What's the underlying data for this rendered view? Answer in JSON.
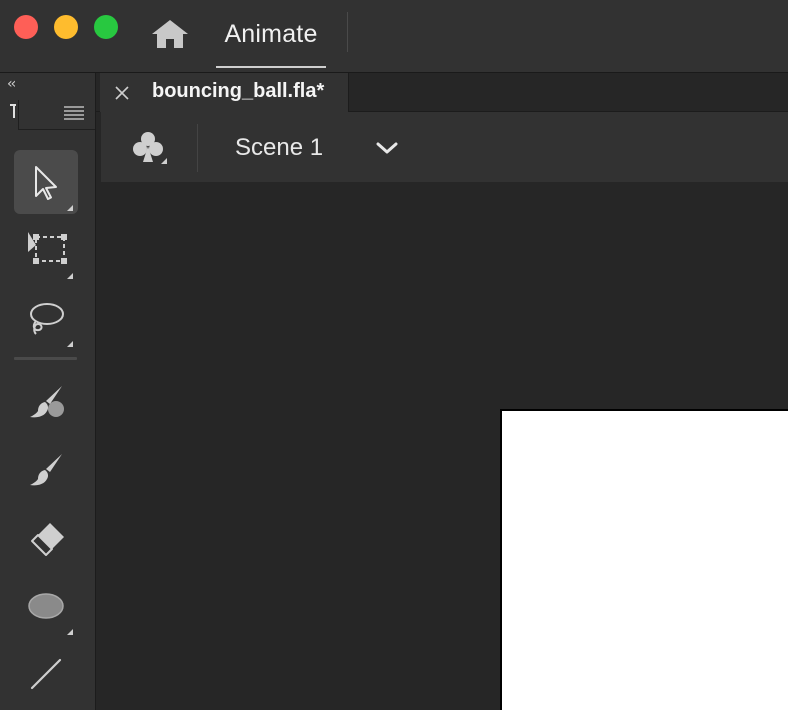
{
  "window": {
    "controls": [
      "close",
      "minimize",
      "maximize"
    ],
    "home_icon": "home-icon",
    "app_tab_label": "Animate"
  },
  "panel": {
    "collapse_glyph": "‹‹",
    "menu_icon": "hamburger-menu-icon"
  },
  "tools": [
    {
      "name": "selection-tool",
      "icon": "arrow-pointer-icon",
      "active": true
    },
    {
      "name": "free-transform-tool",
      "icon": "free-transform-icon",
      "active": false
    },
    {
      "name": "lasso-tool",
      "icon": "lasso-icon",
      "active": false
    },
    {
      "name": "paint-brush-tool",
      "icon": "paint-brush-icon",
      "active": false
    },
    {
      "name": "brush-tool",
      "icon": "brush-icon",
      "active": false
    },
    {
      "name": "eraser-tool",
      "icon": "eraser-icon",
      "active": false
    },
    {
      "name": "oval-tool",
      "icon": "oval-icon",
      "active": false
    },
    {
      "name": "line-tool",
      "icon": "line-icon",
      "active": false
    }
  ],
  "document": {
    "tab_title": "bouncing_ball.fla*",
    "close_glyph": "×"
  },
  "scene_bar": {
    "edit_symbols_icon": "club-symbol-icon",
    "scene_name": "Scene 1",
    "dropdown_icon": "chevron-down-icon"
  },
  "colors": {
    "accent_close": "#fe5f57",
    "accent_minimize": "#febc2e",
    "accent_maximize": "#28c840",
    "panel_bg": "#323232",
    "workspace_bg": "#262626",
    "stage_bg": "#ffffff"
  }
}
